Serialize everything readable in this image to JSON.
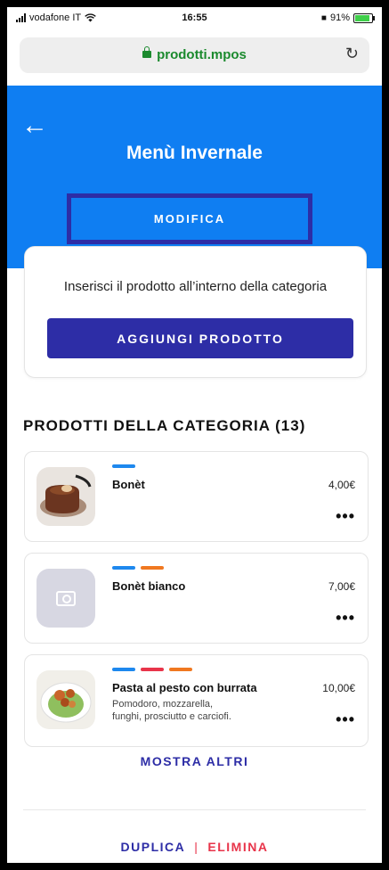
{
  "status_bar": {
    "carrier": "vodafone IT",
    "time": "16:55",
    "battery": "91%",
    "battery_level": 0.91
  },
  "browser": {
    "url": "prodotti.mpos"
  },
  "header": {
    "title": "Menù Invernale",
    "edit_button": "MODIFICA"
  },
  "add_card": {
    "hint": "Inserisci il prodotto all’interno della categoria",
    "add_button": "AGGIUNGI PRODOTTO"
  },
  "section": {
    "title": "PRODOTTI DELLA CATEGORIA (13)"
  },
  "products": [
    {
      "name": "Bonèt",
      "price": "4,00€",
      "description": [],
      "tags": [
        "#1e88ee"
      ],
      "image": "bonet-photo"
    },
    {
      "name": "Bonèt bianco",
      "price": "7,00€",
      "description": [],
      "tags": [
        "#1e88ee",
        "#f07820"
      ],
      "image": "camera-placeholder"
    },
    {
      "name": "Pasta al pesto con burrata",
      "price": "10,00€",
      "description": [
        "Pomodoro, mozzarella,",
        "funghi, prosciutto e carciofi."
      ],
      "tags": [
        "#1e88ee",
        "#e8344a",
        "#f07820"
      ],
      "image": "pasta-photo"
    }
  ],
  "more_button": "MOSTRA ALTRI",
  "footer": {
    "duplicate": "DUPLICA",
    "separator": "|",
    "delete": "ELIMINA"
  },
  "colors": {
    "header_blue": "#0f7ef2",
    "primary": "#2d2da6",
    "danger": "#e8344a"
  }
}
